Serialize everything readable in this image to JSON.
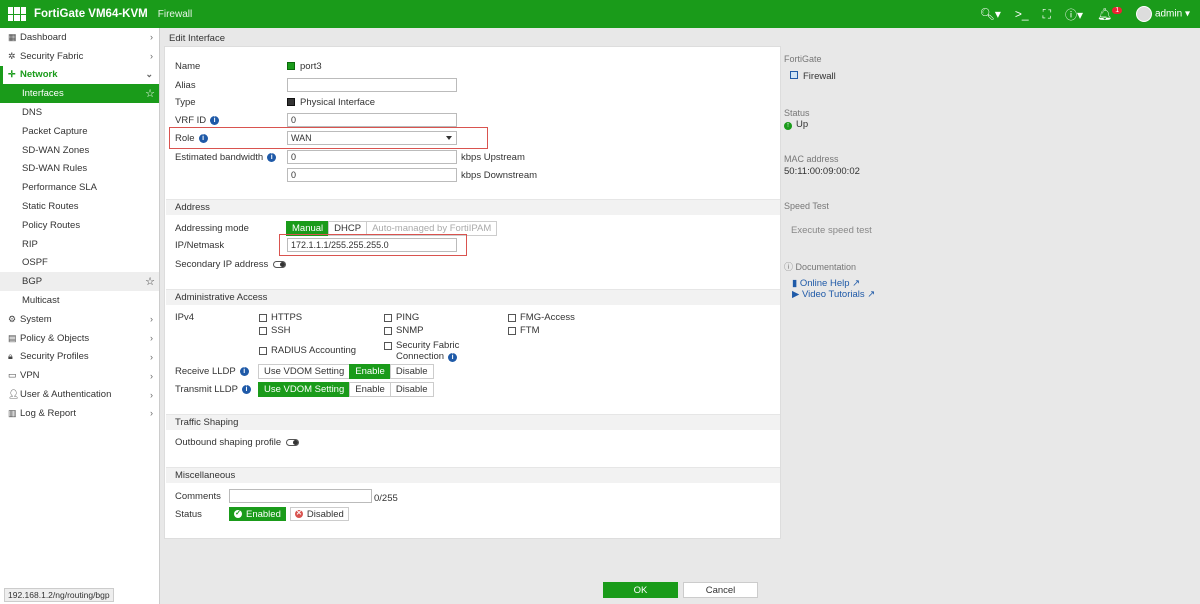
{
  "topbar": {
    "product": "FortiGate VM64-KVM",
    "hostname": "Firewall",
    "user": "admin",
    "alert_count": "1"
  },
  "sidebar": {
    "items": [
      {
        "label": "Dashboard",
        "icon": "dashboard-icon"
      },
      {
        "label": "Security Fabric",
        "icon": "fabric-icon"
      },
      {
        "label": "Network",
        "icon": "network-icon"
      },
      {
        "label": "Interfaces"
      },
      {
        "label": "DNS"
      },
      {
        "label": "Packet Capture"
      },
      {
        "label": "SD-WAN Zones"
      },
      {
        "label": "SD-WAN Rules"
      },
      {
        "label": "Performance SLA"
      },
      {
        "label": "Static Routes"
      },
      {
        "label": "Policy Routes"
      },
      {
        "label": "RIP"
      },
      {
        "label": "OSPF"
      },
      {
        "label": "BGP"
      },
      {
        "label": "Multicast"
      },
      {
        "label": "System",
        "icon": "gear-icon"
      },
      {
        "label": "Policy & Objects",
        "icon": "policy-icon"
      },
      {
        "label": "Security Profiles",
        "icon": "lock-icon"
      },
      {
        "label": "VPN",
        "icon": "vpn-icon"
      },
      {
        "label": "User & Authentication",
        "icon": "user-icon"
      },
      {
        "label": "Log & Report",
        "icon": "chart-icon"
      }
    ]
  },
  "statusbar": "192.168.1.2/ng/routing/bgp",
  "page": {
    "title": "Edit Interface"
  },
  "form": {
    "name_label": "Name",
    "name_value": "port3",
    "alias_label": "Alias",
    "alias_value": "",
    "type_label": "Type",
    "type_value": "Physical Interface",
    "vrf_label": "VRF ID",
    "vrf_value": "0",
    "role_label": "Role",
    "role_value": "WAN",
    "bandwidth_label": "Estimated bandwidth",
    "upstream_value": "0",
    "upstream_unit": "kbps Upstream",
    "downstream_value": "0",
    "downstream_unit": "kbps Downstream",
    "address_section": "Address",
    "addressing_mode_label": "Addressing mode",
    "mode_manual": "Manual",
    "mode_dhcp": "DHCP",
    "mode_fortiipam": "Auto-managed by FortiIPAM",
    "ip_label": "IP/Netmask",
    "ip_value": "172.1.1.1/255.255.255.0",
    "secondary_ip_label": "Secondary IP address",
    "admin_section": "Administrative Access",
    "ipv4_label": "IPv4",
    "access": {
      "https": "HTTPS",
      "ping": "PING",
      "fmg": "FMG-Access",
      "ssh": "SSH",
      "snmp": "SNMP",
      "ftm": "FTM",
      "radius": "RADIUS Accounting",
      "fabric": "Security Fabric",
      "fabric2": "Connection"
    },
    "receive_lldp_label": "Receive LLDP",
    "transmit_lldp_label": "Transmit LLDP",
    "lldp_vdom": "Use VDOM Setting",
    "lldp_enable": "Enable",
    "lldp_disable": "Disable",
    "shaping_section": "Traffic Shaping",
    "outbound_label": "Outbound shaping profile",
    "misc_section": "Miscellaneous",
    "comments_label": "Comments",
    "comments_value": "",
    "comments_counter": "0/255",
    "status_label": "Status",
    "status_enabled": "Enabled",
    "status_disabled": "Disabled"
  },
  "right_panel": {
    "device_title": "FortiGate",
    "device_value": "Firewall",
    "status_title": "Status",
    "status_value": "Up",
    "mac_title": "MAC address",
    "mac_value": "50:11:00:09:00:02",
    "speed_title": "Speed Test",
    "speed_button": "Execute speed test",
    "doc_title": "Documentation",
    "help_link": "Online Help",
    "video_link": "Video Tutorials"
  },
  "footer": {
    "ok": "OK",
    "cancel": "Cancel"
  },
  "colors": {
    "brand_green": "#1a9b1a",
    "highlight_red": "#d9534f",
    "info_blue": "#1f5aa8"
  }
}
